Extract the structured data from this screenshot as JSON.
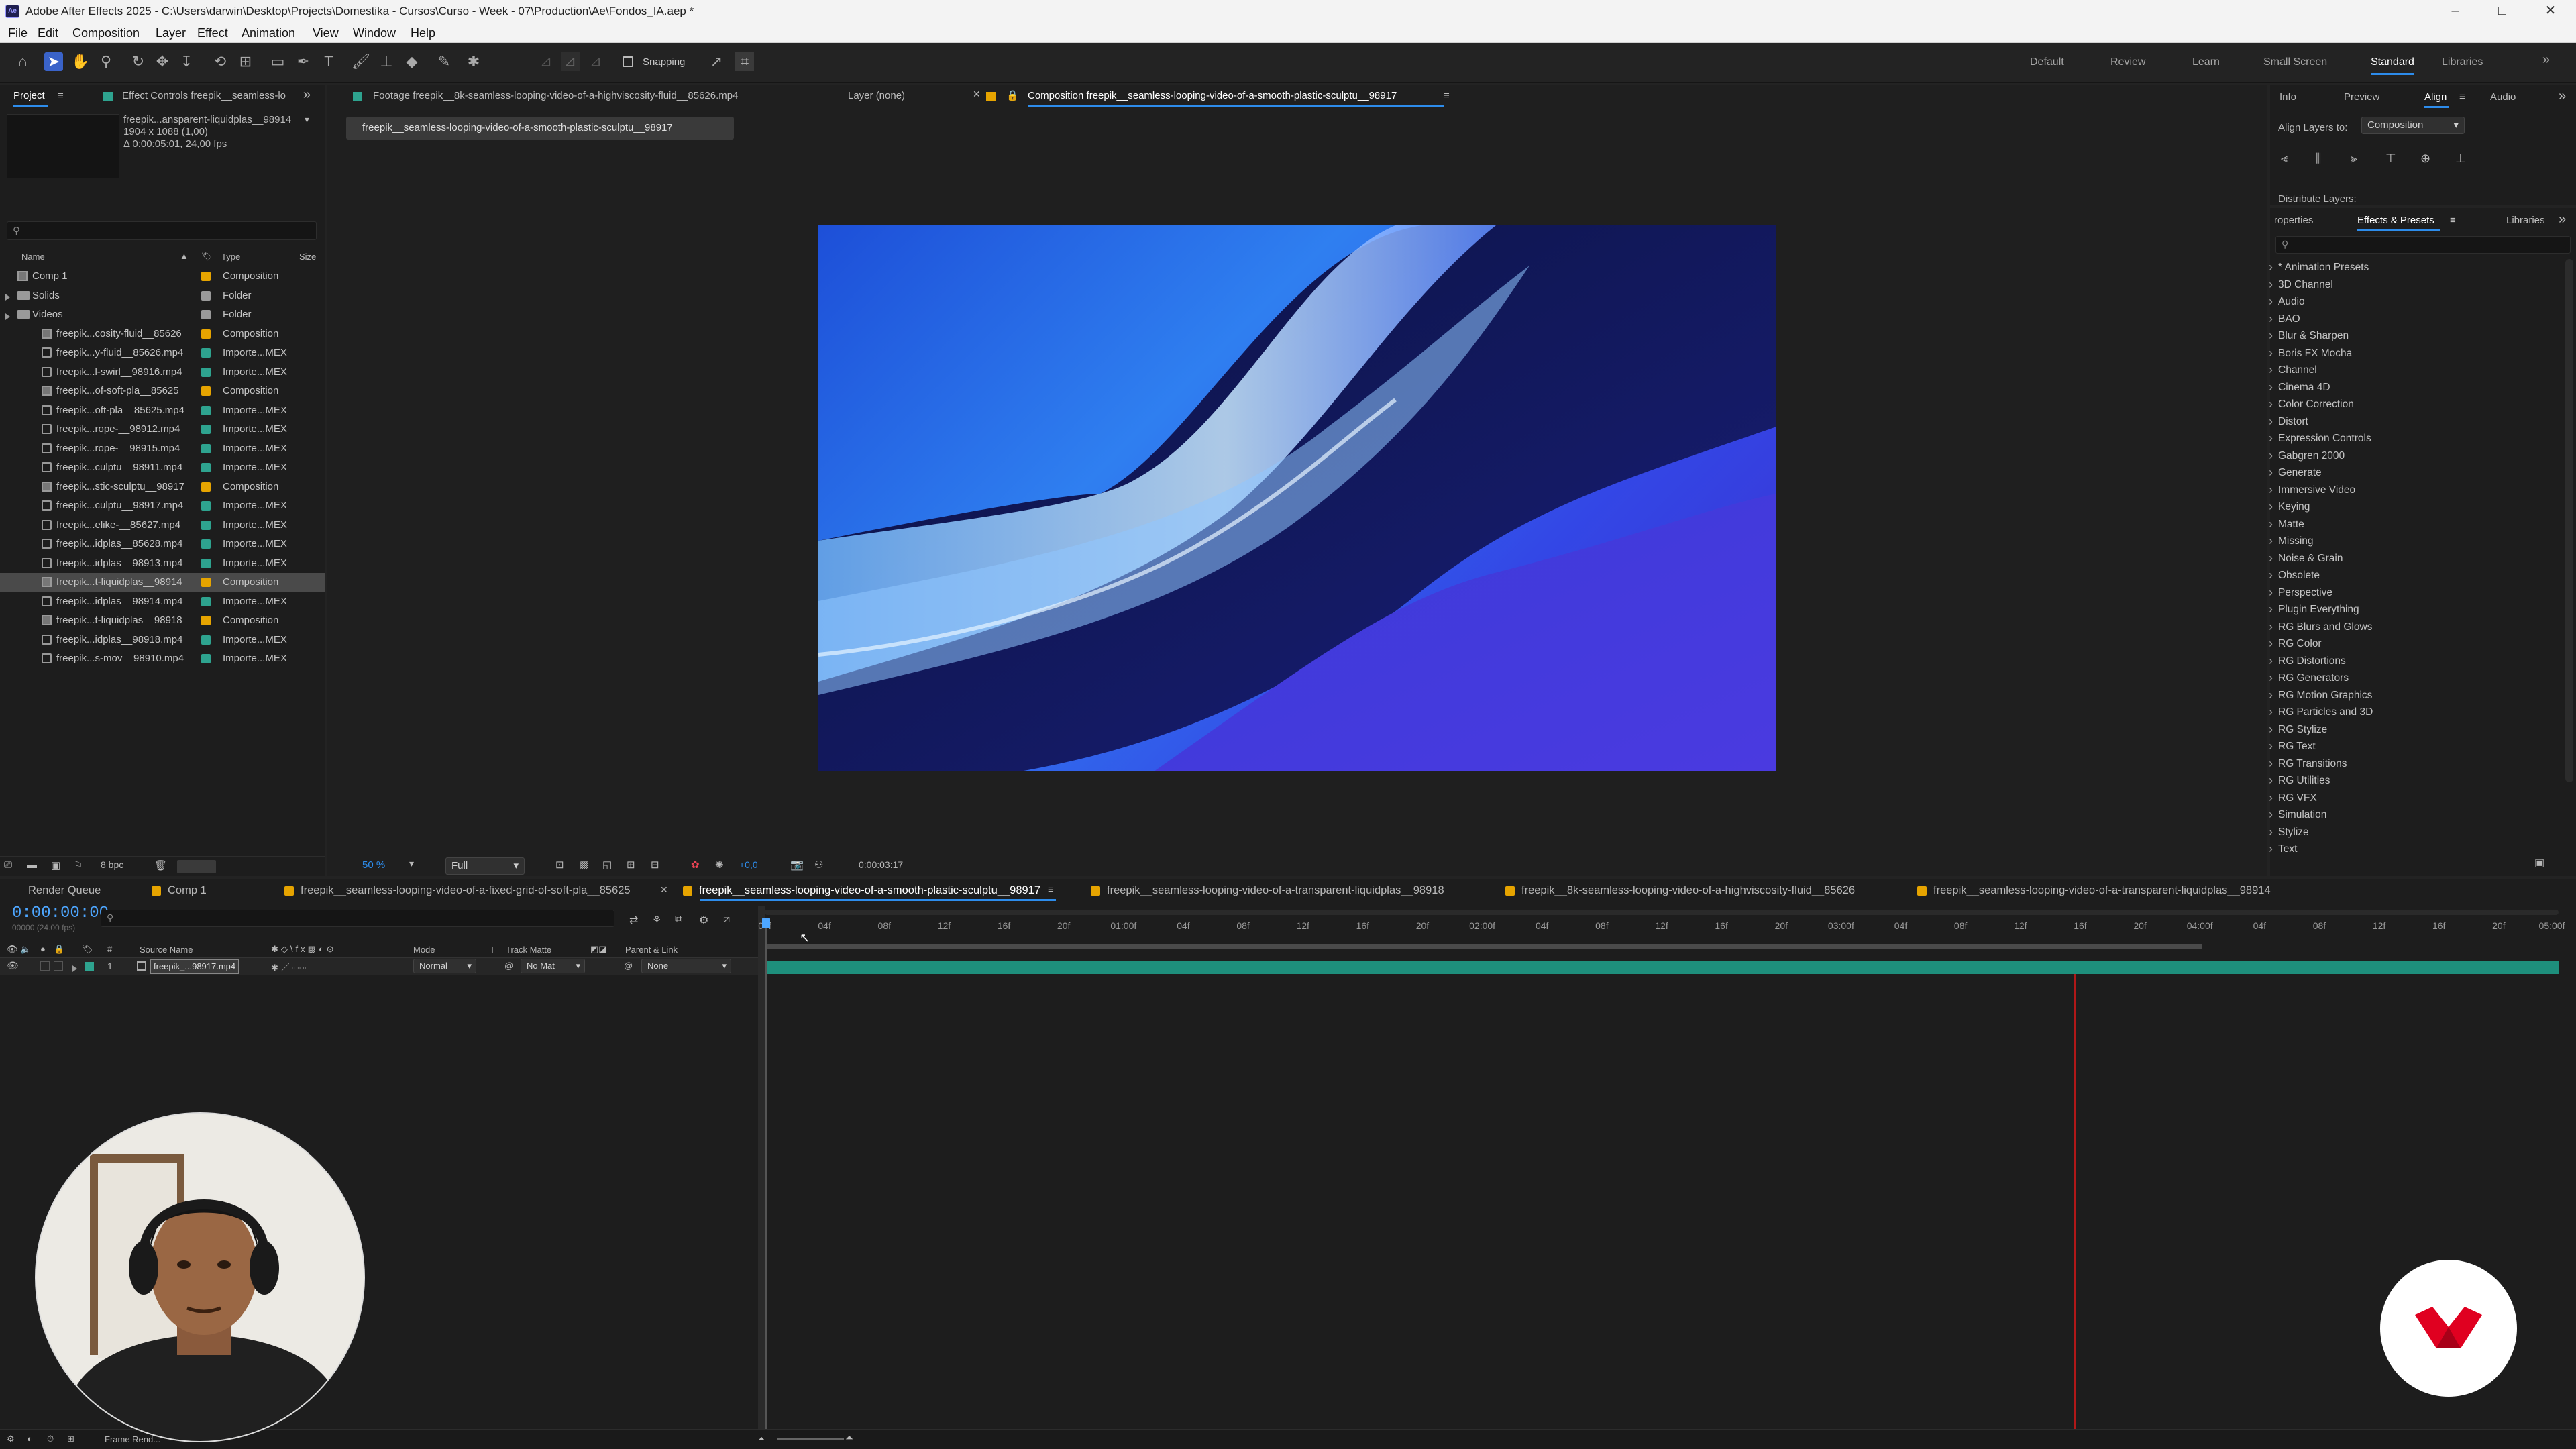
{
  "window": {
    "title": "Adobe After Effects 2025 - C:\\Users\\darwin\\Desktop\\Projects\\Domestika - Cursos\\Curso - Week - 07\\Production\\Ae\\Fondos_IA.aep *",
    "min": "–",
    "max": "□",
    "close": "✕"
  },
  "menu": [
    "File",
    "Edit",
    "Composition",
    "Layer",
    "Effect",
    "Animation",
    "View",
    "Window",
    "Help"
  ],
  "toolbar": {
    "snapping_label": "Snapping",
    "workspaces": [
      "Default",
      "Review",
      "Learn",
      "Small Screen",
      "Standard",
      "Libraries"
    ],
    "active_workspace": "Standard",
    "more": "»"
  },
  "project_panel": {
    "tab_project": "Project",
    "tab_effect_controls": "Effect Controls freepik__seamless-lo",
    "preview_name": "freepik...ansparent-liquidplas__98914",
    "preview_size": "1904 x 1088 (1,00)",
    "preview_duration": "Δ 0:00:05:01, 24,00 fps",
    "search_placeholder": "",
    "col_name": "Name",
    "col_type": "Type",
    "col_size": "Size",
    "items": [
      {
        "name": "Comp 1",
        "type": "Composition",
        "kind": "comp",
        "color": "#e6a400",
        "indent": 0
      },
      {
        "name": "Solids",
        "type": "Folder",
        "kind": "folder",
        "color": "#9a9a9a",
        "indent": 0
      },
      {
        "name": "Videos",
        "type": "Folder",
        "kind": "folder",
        "color": "#9a9a9a",
        "indent": 0
      },
      {
        "name": "freepik...cosity-fluid__85626",
        "type": "Composition",
        "kind": "comp",
        "color": "#e6a400",
        "indent": 1
      },
      {
        "name": "freepik...y-fluid__85626.mp4",
        "type": "Importe...MEX",
        "kind": "file",
        "color": "#2ea38f",
        "indent": 1
      },
      {
        "name": "freepik...l-swirl__98916.mp4",
        "type": "Importe...MEX",
        "kind": "file",
        "color": "#2ea38f",
        "indent": 1
      },
      {
        "name": "freepik...of-soft-pla__85625",
        "type": "Composition",
        "kind": "comp",
        "color": "#e6a400",
        "indent": 1
      },
      {
        "name": "freepik...oft-pla__85625.mp4",
        "type": "Importe...MEX",
        "kind": "file",
        "color": "#2ea38f",
        "indent": 1
      },
      {
        "name": "freepik...rope-__98912.mp4",
        "type": "Importe...MEX",
        "kind": "file",
        "color": "#2ea38f",
        "indent": 1
      },
      {
        "name": "freepik...rope-__98915.mp4",
        "type": "Importe...MEX",
        "kind": "file",
        "color": "#2ea38f",
        "indent": 1
      },
      {
        "name": "freepik...culptu__98911.mp4",
        "type": "Importe...MEX",
        "kind": "file",
        "color": "#2ea38f",
        "indent": 1
      },
      {
        "name": "freepik...stic-sculptu__98917",
        "type": "Composition",
        "kind": "comp",
        "color": "#e6a400",
        "indent": 1
      },
      {
        "name": "freepik...culptu__98917.mp4",
        "type": "Importe...MEX",
        "kind": "file",
        "color": "#2ea38f",
        "indent": 1
      },
      {
        "name": "freepik...elike-__85627.mp4",
        "type": "Importe...MEX",
        "kind": "file",
        "color": "#2ea38f",
        "indent": 1
      },
      {
        "name": "freepik...idplas__85628.mp4",
        "type": "Importe...MEX",
        "kind": "file",
        "color": "#2ea38f",
        "indent": 1
      },
      {
        "name": "freepik...idplas__98913.mp4",
        "type": "Importe...MEX",
        "kind": "file",
        "color": "#2ea38f",
        "indent": 1
      },
      {
        "name": "freepik...t-liquidplas__98914",
        "type": "Composition",
        "kind": "comp",
        "color": "#e6a400",
        "indent": 1,
        "selected": true
      },
      {
        "name": "freepik...idplas__98914.mp4",
        "type": "Importe...MEX",
        "kind": "file",
        "color": "#2ea38f",
        "indent": 1
      },
      {
        "name": "freepik...t-liquidplas__98918",
        "type": "Composition",
        "kind": "comp",
        "color": "#e6a400",
        "indent": 1
      },
      {
        "name": "freepik...idplas__98918.mp4",
        "type": "Importe...MEX",
        "kind": "file",
        "color": "#2ea38f",
        "indent": 1
      },
      {
        "name": "freepik...s-mov__98910.mp4",
        "type": "Importe...MEX",
        "kind": "file",
        "color": "#2ea38f",
        "indent": 1
      }
    ],
    "bpc": "8 bpc"
  },
  "viewer": {
    "tab_footage": "Footage freepik__8k-seamless-looping-video-of-a-highviscosity-fluid__85626.mp4",
    "tab_layer": "Layer (none)",
    "tab_composition": "Composition freepik__seamless-looping-video-of-a-smooth-plastic-sculptu__98917",
    "breadcrumb": "freepik__seamless-looping-video-of-a-smooth-plastic-sculptu__98917",
    "zoom": "50 %",
    "resolution": "Full",
    "exposure": "+0,0",
    "timecode": "0:00:03:17"
  },
  "right_panel": {
    "tabs": [
      "Info",
      "Preview",
      "Align",
      "Audio"
    ],
    "active_tab": "Align",
    "align_layers_to_label": "Align Layers to:",
    "align_layers_to_value": "Composition",
    "distribute_label": "Distribute Layers:",
    "lower_tabs": [
      "roperties",
      "Effects & Presets",
      "Libraries"
    ],
    "effects": [
      "* Animation Presets",
      "3D Channel",
      "Audio",
      "BAO",
      "Blur & Sharpen",
      "Boris FX Mocha",
      "Channel",
      "Cinema 4D",
      "Color Correction",
      "Distort",
      "Expression Controls",
      "Gabgren 2000",
      "Generate",
      "Immersive Video",
      "Keying",
      "Matte",
      "Missing",
      "Noise & Grain",
      "Obsolete",
      "Perspective",
      "Plugin Everything",
      "RG Blurs and Glows",
      "RG Color",
      "RG Distortions",
      "RG Generators",
      "RG Motion Graphics",
      "RG Particles and 3D",
      "RG Stylize",
      "RG Text",
      "RG Transitions",
      "RG Utilities",
      "RG VFX",
      "Simulation",
      "Stylize",
      "Text"
    ]
  },
  "timeline": {
    "tabs": [
      {
        "label": "Render Queue",
        "color": ""
      },
      {
        "label": "Comp 1",
        "color": "#e6a400"
      },
      {
        "label": "freepik__seamless-looping-video-of-a-fixed-grid-of-soft-pla__85625",
        "color": "#e6a400"
      },
      {
        "label": "freepik__seamless-looping-video-of-a-smooth-plastic-sculptu__98917",
        "color": "#e6a400",
        "active": true
      },
      {
        "label": "freepik__seamless-looping-video-of-a-transparent-liquidplas__98918",
        "color": "#e6a400"
      },
      {
        "label": "freepik__8k-seamless-looping-video-of-a-highviscosity-fluid__85626",
        "color": "#e6a400"
      },
      {
        "label": "freepik__seamless-looping-video-of-a-transparent-liquidplas__98914",
        "color": "#e6a400"
      }
    ],
    "current_time": "0:00:00:00",
    "fps_note": "00000 (24.00 fps)",
    "columns": {
      "source_name": "Source Name",
      "mode": "Mode",
      "t": "T",
      "track_matte": "Track Matte",
      "parent": "Parent & Link"
    },
    "layer": {
      "index": "1",
      "name": "freepik_...98917.mp4",
      "mode": "Normal",
      "matte": "No Mat",
      "parent": "None"
    },
    "ticks": [
      "00f",
      "04f",
      "08f",
      "12f",
      "16f",
      "20f",
      "01:00f",
      "04f",
      "08f",
      "12f",
      "16f",
      "20f",
      "02:00f",
      "04f",
      "08f",
      "12f",
      "16f",
      "20f",
      "03:00f",
      "04f",
      "08f",
      "12f",
      "16f",
      "20f",
      "04:00f",
      "04f",
      "08f",
      "12f",
      "16f",
      "20f",
      "05:00f"
    ],
    "work_area_end_fraction": 0.801,
    "cti_fraction": 0.0,
    "red_marker_fraction": 0.73,
    "frame_render_label": "Frame Rend..."
  }
}
